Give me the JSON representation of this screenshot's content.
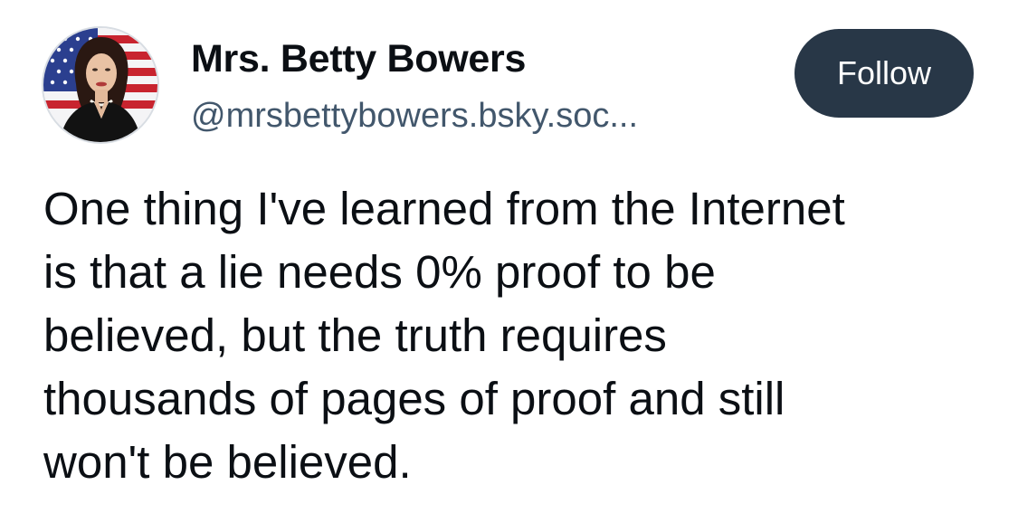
{
  "author": {
    "display_name": "Mrs. Betty Bowers",
    "handle": "@mrsbettybowers.bsky.soc...",
    "avatar_icon": "profile-photo-with-flag-background"
  },
  "actions": {
    "follow_label": "Follow"
  },
  "post": {
    "lines": [
      "One thing I've learned from the Internet",
      "is that a lie needs 0% proof to be",
      "believed, but the truth requires",
      "thousands of pages of proof and still",
      "won't be believed."
    ]
  },
  "colors": {
    "follow_button_bg": "#283747",
    "handle_text": "#42576c",
    "body_text": "#0b0f14"
  }
}
